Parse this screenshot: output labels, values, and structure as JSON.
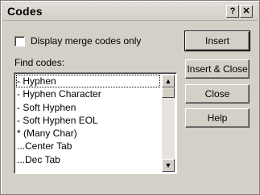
{
  "window": {
    "title": "Codes",
    "help_button": "?",
    "close_button": "✕"
  },
  "checkbox": {
    "label": "Display merge codes only",
    "checked": false
  },
  "find_label": "Find codes:",
  "codes_list": {
    "items": [
      "- Hyphen",
      "- Hyphen Character",
      "- Soft Hyphen",
      "- Soft Hyphen EOL",
      "* (Many Char)",
      "...Center Tab",
      "...Dec Tab"
    ],
    "selected_index": 0
  },
  "scrollbar": {
    "up_arrow": "▲",
    "down_arrow": "▼"
  },
  "buttons": {
    "insert": "Insert",
    "insert_close": "Insert & Close",
    "close": "Close",
    "help": "Help"
  }
}
